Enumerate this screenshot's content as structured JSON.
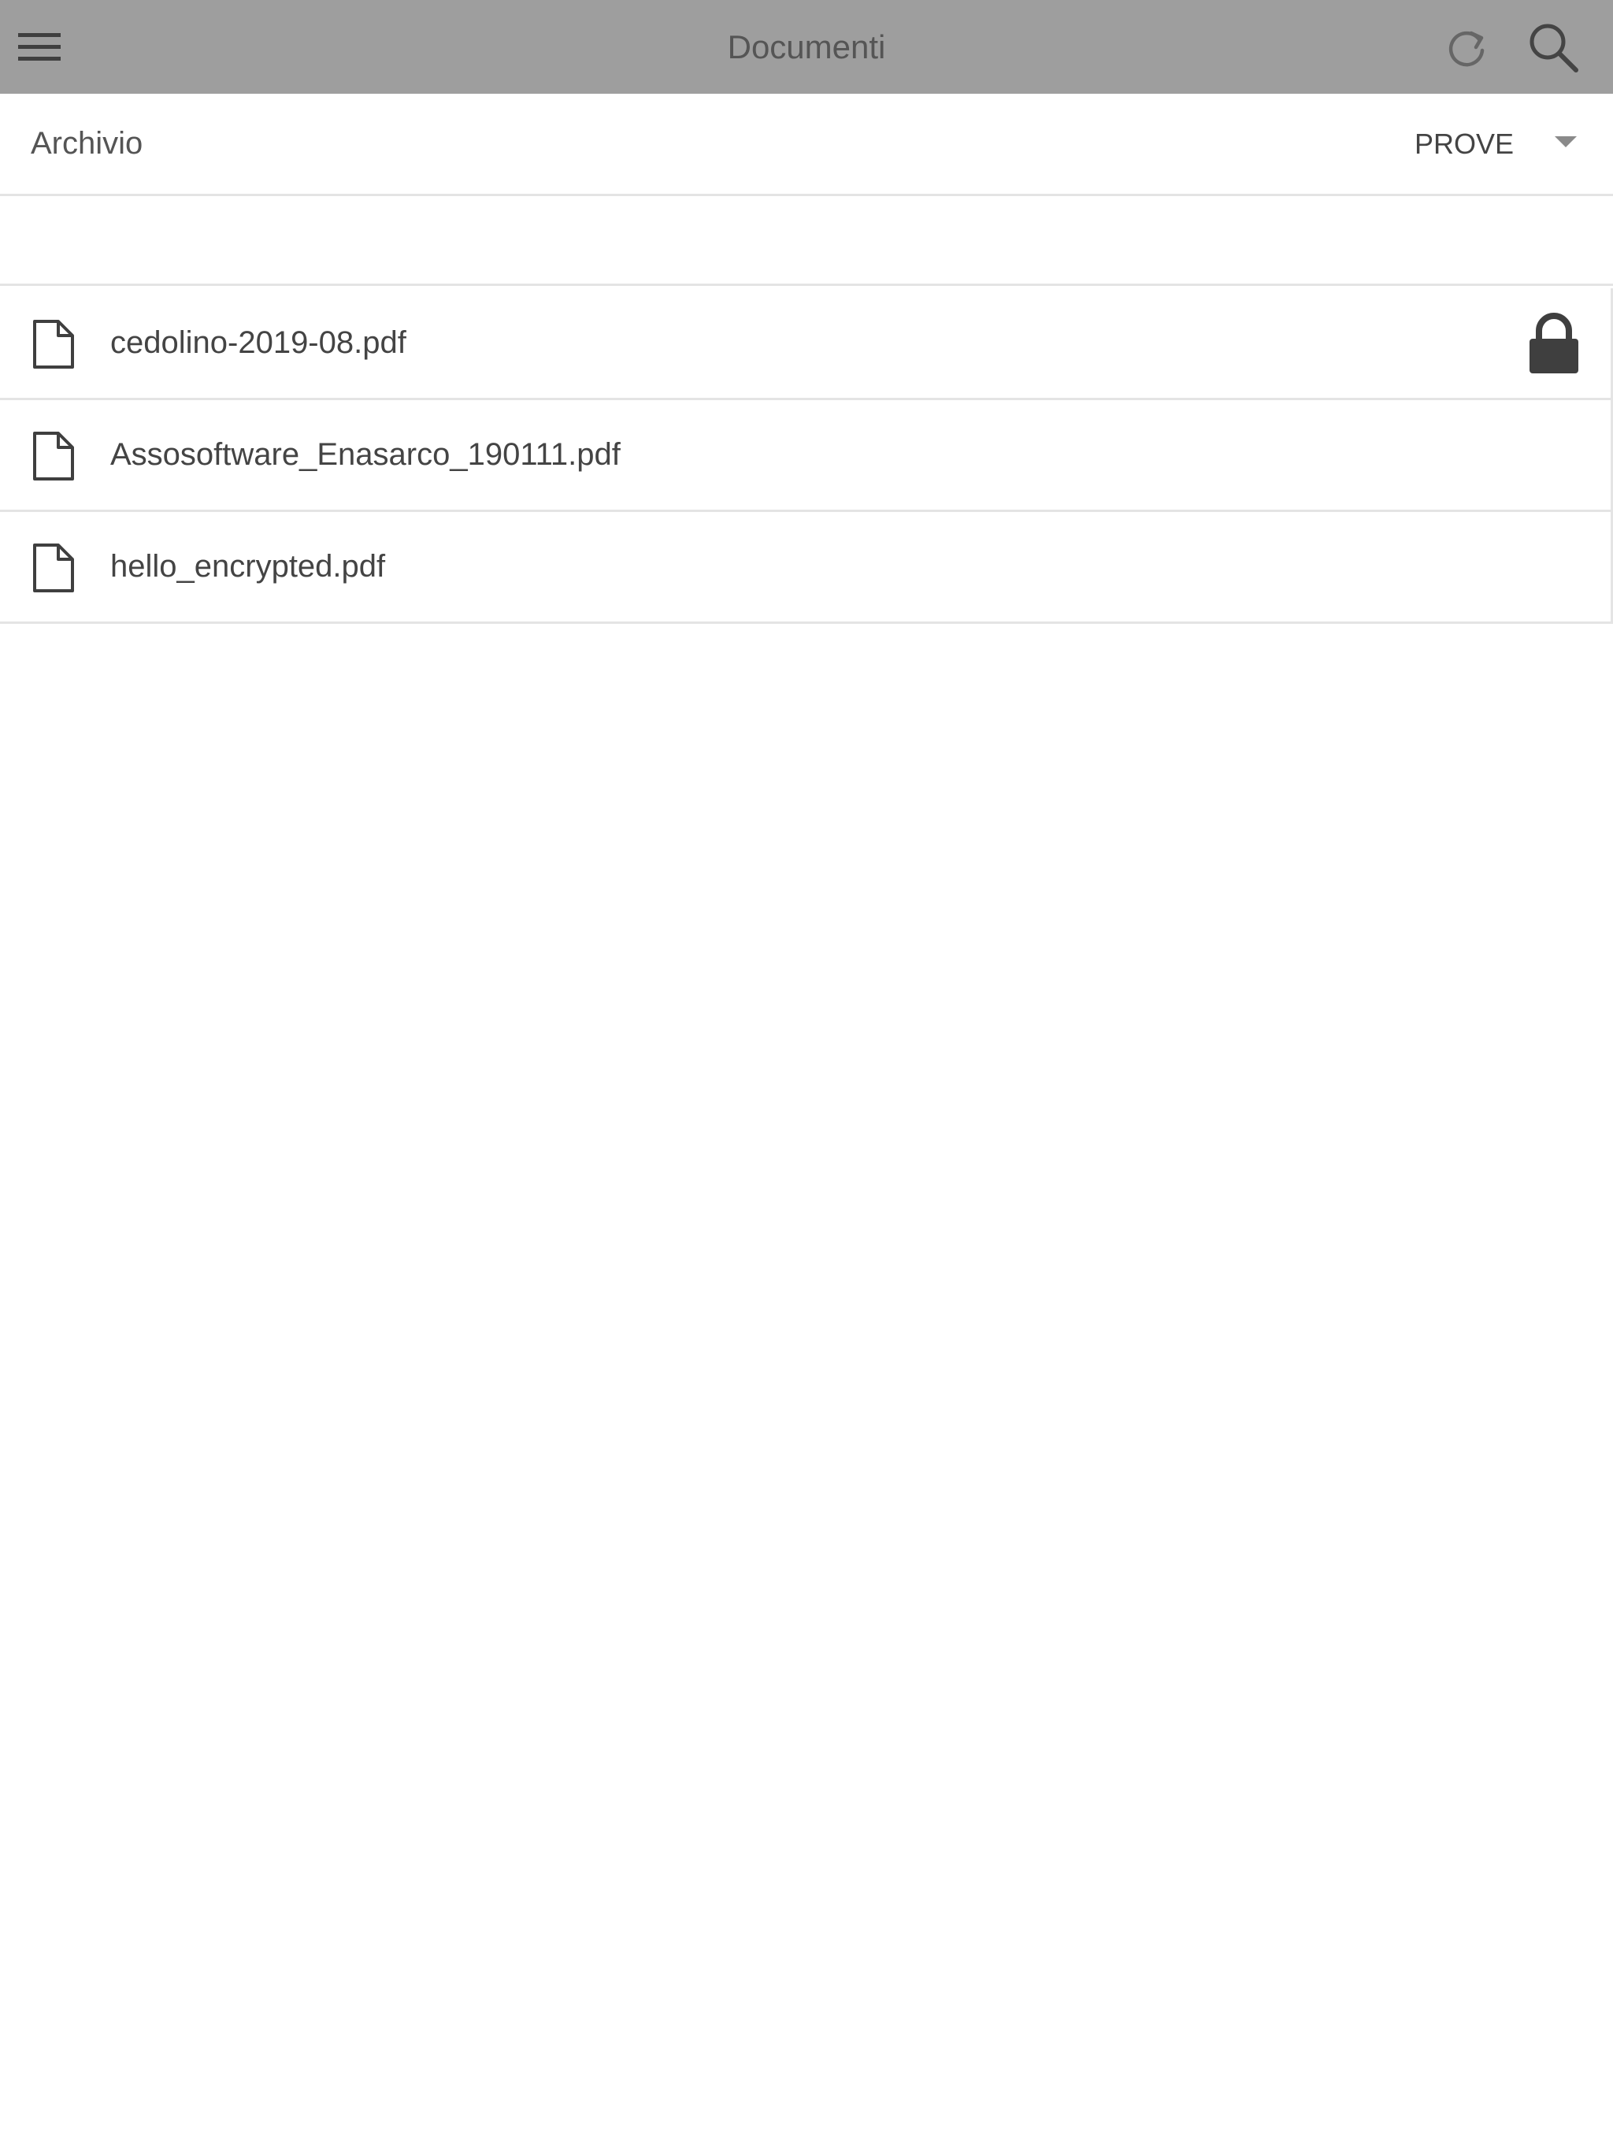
{
  "header": {
    "title": "Documenti",
    "icons": {
      "menu": "hamburger-menu-icon",
      "refresh": "refresh-icon",
      "search": "search-icon"
    }
  },
  "archive": {
    "label": "Archivio",
    "selected": "PROVE"
  },
  "files": [
    {
      "name": "cedolino-2019-08.pdf",
      "locked": true
    },
    {
      "name": "Assosoftware_Enasarco_190111.pdf",
      "locked": false
    },
    {
      "name": "hello_encrypted.pdf",
      "locked": false
    }
  ],
  "colors": {
    "topbar": "#9e9e9e",
    "text": "#444444",
    "divider": "#e4e4e4",
    "icon": "#3f3f3f"
  }
}
